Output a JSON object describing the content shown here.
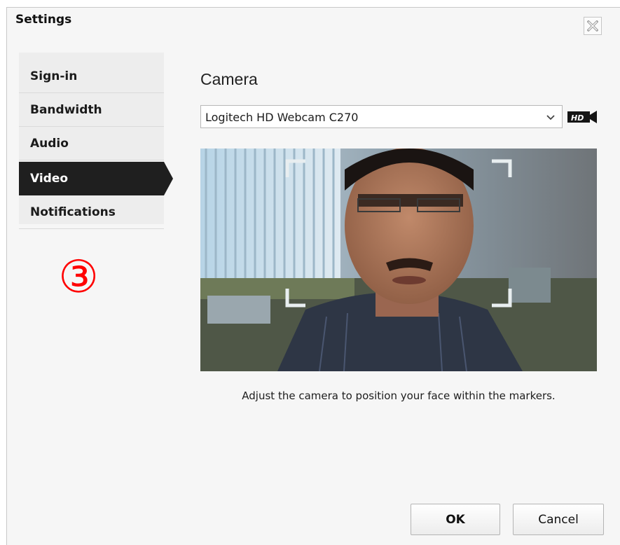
{
  "dialog": {
    "title": "Settings",
    "close_icon": "close-x-icon"
  },
  "sidebar": {
    "items": [
      {
        "label": "Sign-in",
        "active": false
      },
      {
        "label": "Bandwidth",
        "active": false
      },
      {
        "label": "Audio",
        "active": false
      },
      {
        "label": "Video",
        "active": true
      },
      {
        "label": "Notifications",
        "active": false
      }
    ]
  },
  "annotation": {
    "step": "③",
    "color": "#ff0000"
  },
  "camera": {
    "section_title": "Camera",
    "selected_device": "Logitech HD Webcam C270",
    "hd_badge": "HD",
    "hint": "Adjust the camera to position your face within the markers."
  },
  "buttons": {
    "ok": "OK",
    "cancel": "Cancel"
  },
  "colors": {
    "active_item": "#1f1f1f",
    "dialog_bg": "#f6f6f6"
  }
}
